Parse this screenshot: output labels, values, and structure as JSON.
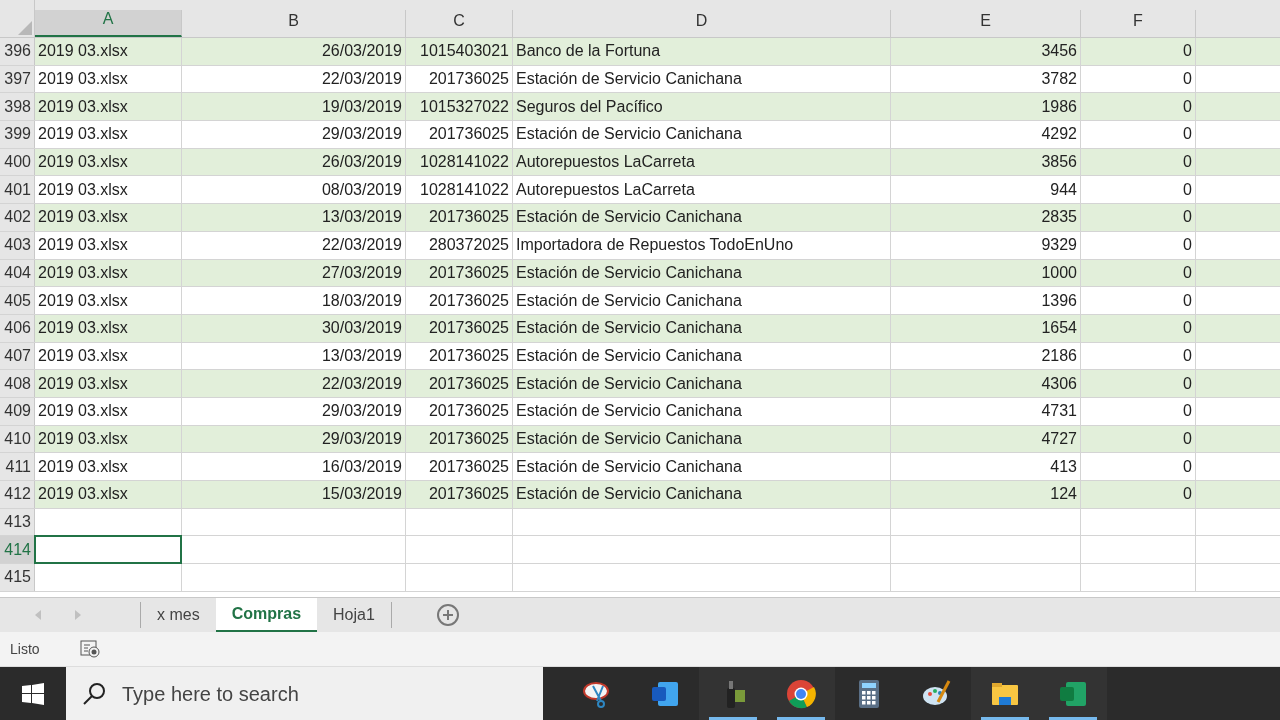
{
  "columns": [
    {
      "label": "A",
      "selected": true
    },
    {
      "label": "B",
      "selected": false
    },
    {
      "label": "C",
      "selected": false
    },
    {
      "label": "D",
      "selected": false
    },
    {
      "label": "E",
      "selected": false
    },
    {
      "label": "F",
      "selected": false
    }
  ],
  "rows": [
    {
      "num": "396",
      "selected": false,
      "cells": [
        "2019 03.xlsx",
        "26/03/2019",
        "1015403021",
        "Banco de la Fortuna",
        "3456",
        "0"
      ]
    },
    {
      "num": "397",
      "selected": false,
      "cells": [
        "2019 03.xlsx",
        "22/03/2019",
        "201736025",
        "Estación de Servicio Canichana",
        "3782",
        "0"
      ]
    },
    {
      "num": "398",
      "selected": false,
      "cells": [
        "2019 03.xlsx",
        "19/03/2019",
        "1015327022",
        "Seguros del Pacífico",
        "1986",
        "0"
      ]
    },
    {
      "num": "399",
      "selected": false,
      "cells": [
        "2019 03.xlsx",
        "29/03/2019",
        "201736025",
        "Estación de Servicio Canichana",
        "4292",
        "0"
      ]
    },
    {
      "num": "400",
      "selected": false,
      "cells": [
        "2019 03.xlsx",
        "26/03/2019",
        "1028141022",
        "Autorepuestos LaCarreta",
        "3856",
        "0"
      ]
    },
    {
      "num": "401",
      "selected": false,
      "cells": [
        "2019 03.xlsx",
        "08/03/2019",
        "1028141022",
        "Autorepuestos LaCarreta",
        "944",
        "0"
      ]
    },
    {
      "num": "402",
      "selected": false,
      "cells": [
        "2019 03.xlsx",
        "13/03/2019",
        "201736025",
        "Estación de Servicio Canichana",
        "2835",
        "0"
      ]
    },
    {
      "num": "403",
      "selected": false,
      "cells": [
        "2019 03.xlsx",
        "22/03/2019",
        "280372025",
        "Importadora de Repuestos TodoEnUno",
        "9329",
        "0"
      ]
    },
    {
      "num": "404",
      "selected": false,
      "cells": [
        "2019 03.xlsx",
        "27/03/2019",
        "201736025",
        "Estación de Servicio Canichana",
        "1000",
        "0"
      ]
    },
    {
      "num": "405",
      "selected": false,
      "cells": [
        "2019 03.xlsx",
        "18/03/2019",
        "201736025",
        "Estación de Servicio Canichana",
        "1396",
        "0"
      ]
    },
    {
      "num": "406",
      "selected": false,
      "cells": [
        "2019 03.xlsx",
        "30/03/2019",
        "201736025",
        "Estación de Servicio Canichana",
        "1654",
        "0"
      ]
    },
    {
      "num": "407",
      "selected": false,
      "cells": [
        "2019 03.xlsx",
        "13/03/2019",
        "201736025",
        "Estación de Servicio Canichana",
        "2186",
        "0"
      ]
    },
    {
      "num": "408",
      "selected": false,
      "cells": [
        "2019 03.xlsx",
        "22/03/2019",
        "201736025",
        "Estación de Servicio Canichana",
        "4306",
        "0"
      ]
    },
    {
      "num": "409",
      "selected": false,
      "cells": [
        "2019 03.xlsx",
        "29/03/2019",
        "201736025",
        "Estación de Servicio Canichana",
        "4731",
        "0"
      ]
    },
    {
      "num": "410",
      "selected": false,
      "cells": [
        "2019 03.xlsx",
        "29/03/2019",
        "201736025",
        "Estación de Servicio Canichana",
        "4727",
        "0"
      ]
    },
    {
      "num": "411",
      "selected": false,
      "cells": [
        "2019 03.xlsx",
        "16/03/2019",
        "201736025",
        "Estación de Servicio Canichana",
        "413",
        "0"
      ]
    },
    {
      "num": "412",
      "selected": false,
      "cells": [
        "2019 03.xlsx",
        "15/03/2019",
        "201736025",
        "Estación de Servicio Canichana",
        "124",
        "0"
      ]
    },
    {
      "num": "413",
      "selected": false
    },
    {
      "num": "414",
      "selected": true
    },
    {
      "num": "415",
      "selected": false
    }
  ],
  "sheet_tabs": [
    {
      "label": "x mes",
      "selected": false
    },
    {
      "label": "Compras",
      "selected": true
    },
    {
      "label": "Hoja1",
      "selected": false
    }
  ],
  "status_bar": {
    "text": "Listo"
  },
  "taskbar": {
    "search": {
      "placeholder": "Type here to search"
    },
    "apps": [
      {
        "kind": "scissors",
        "running": false
      },
      {
        "kind": "document",
        "running": false
      },
      {
        "kind": "usb",
        "running": true
      },
      {
        "kind": "browser",
        "running": true
      },
      {
        "kind": "calculator",
        "running": false
      },
      {
        "kind": "palette",
        "running": false
      },
      {
        "kind": "folder",
        "running": true
      },
      {
        "kind": "spreadsheet",
        "running": true
      }
    ]
  }
}
